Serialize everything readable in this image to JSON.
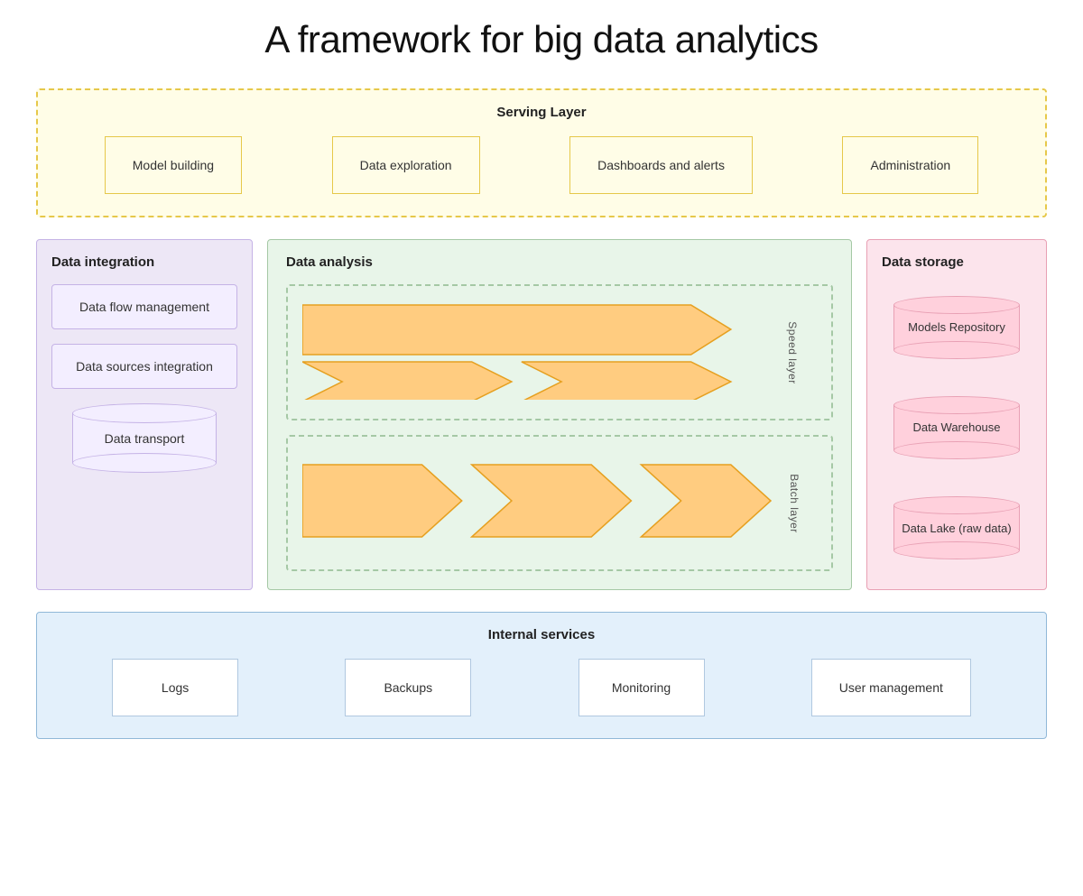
{
  "title": "A framework for big data analytics",
  "serving_layer": {
    "title": "Serving Layer",
    "items": [
      {
        "label": "Model building"
      },
      {
        "label": "Data exploration"
      },
      {
        "label": "Dashboards and alerts"
      },
      {
        "label": "Administration"
      }
    ]
  },
  "data_integration": {
    "title": "Data integration",
    "items": [
      {
        "label": "Data flow management"
      },
      {
        "label": "Data sources integration"
      },
      {
        "label": "Data transport"
      }
    ]
  },
  "data_analysis": {
    "title": "Data analysis",
    "speed_layer_label": "Speed layer",
    "batch_layer_label": "Batch layer"
  },
  "data_storage": {
    "title": "Data storage",
    "items": [
      {
        "label": "Models Repository"
      },
      {
        "label": "Data Warehouse"
      },
      {
        "label": "Data Lake (raw data)"
      }
    ]
  },
  "internal_services": {
    "title": "Internal services",
    "items": [
      {
        "label": "Logs"
      },
      {
        "label": "Backups"
      },
      {
        "label": "Monitoring"
      },
      {
        "label": "User management"
      }
    ]
  }
}
